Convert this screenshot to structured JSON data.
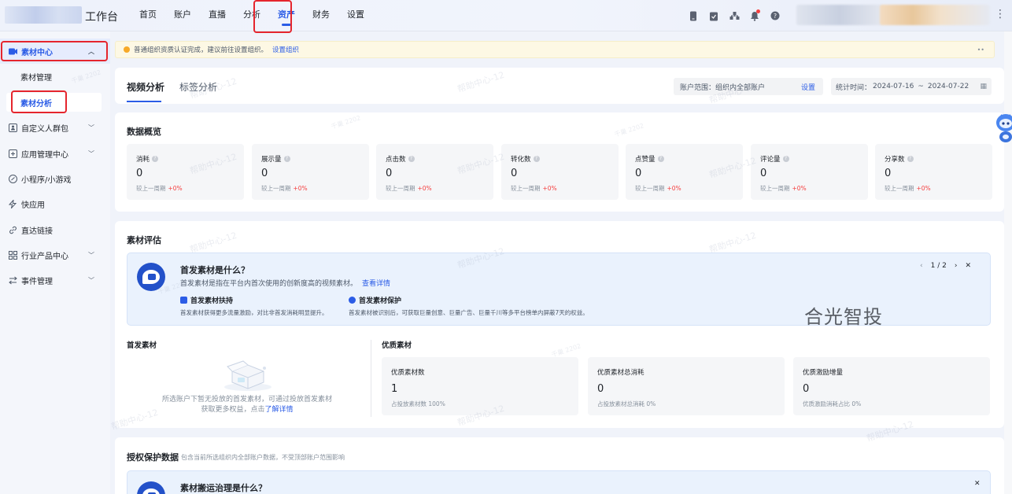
{
  "header": {
    "app_title": "工作台",
    "nav": [
      "首页",
      "账户",
      "直播",
      "分析",
      "资产",
      "财务",
      "设置"
    ],
    "active_nav": "资产",
    "icons": [
      "mobile-icon",
      "clipboard-icon",
      "org-icon",
      "bell-icon",
      "help-icon"
    ]
  },
  "sidebar": {
    "material_center": "素材中心",
    "sub_manage": "素材管理",
    "sub_analysis": "素材分析",
    "items": [
      {
        "label": "自定义人群包",
        "icon": "audience-icon",
        "chevron": true
      },
      {
        "label": "应用管理中心",
        "icon": "app-icon",
        "chevron": true
      },
      {
        "label": "小程序/小游戏",
        "icon": "miniprogram-icon",
        "chevron": false
      },
      {
        "label": "快应用",
        "icon": "quickapp-icon",
        "chevron": false
      },
      {
        "label": "直达链接",
        "icon": "link-icon",
        "chevron": false
      },
      {
        "label": "行业产品中心",
        "icon": "grid-icon",
        "chevron": true
      },
      {
        "label": "事件管理",
        "icon": "event-icon",
        "chevron": true
      }
    ]
  },
  "notice": {
    "text": "普通组织资质认证完成，建议前往设置组织。",
    "link": "设置组织"
  },
  "tabs": {
    "video": "视频分析",
    "tag": "标签分析"
  },
  "filters": {
    "range_label": "账户范围：组织内全部账户",
    "range_set": "设置",
    "date_label": "统计时间：",
    "date_start": "2024-07-16",
    "date_sep": "~",
    "date_end": "2024-07-22"
  },
  "overview": {
    "title": "数据概览",
    "compare_label": "较上一周期",
    "stats": [
      {
        "label": "消耗",
        "value": "0",
        "change": "+0%"
      },
      {
        "label": "展示量",
        "value": "0",
        "change": "+0%"
      },
      {
        "label": "点击数",
        "value": "0",
        "change": "+0%"
      },
      {
        "label": "转化数",
        "value": "0",
        "change": "+0%"
      },
      {
        "label": "点赞量",
        "value": "0",
        "change": "+0%"
      },
      {
        "label": "评论量",
        "value": "0",
        "change": "+0%"
      },
      {
        "label": "分享数",
        "value": "0",
        "change": "+0%"
      }
    ]
  },
  "evaluation": {
    "title": "素材评估",
    "banner": {
      "title": "首发素材是什么？",
      "desc": "首发素材是指在平台内首次使用的创新度高的视频素材。",
      "link": "查看详情",
      "h1": "首发素材扶持",
      "p1": "首发素材获得更多流量激励，对比非首发消耗明显提升。",
      "h2": "首发素材保护",
      "p2": "首发素材被识别后，可获取巨量创意、巨量广告、巨量千川等多平台榜单内屏蔽7天的权益。",
      "pager": "1 / 2"
    },
    "watermark": "合光智投",
    "first_title": "首发素材",
    "empty_text": "所选账户下暂无投放的首发素材，可通过投放首发素材获取更多权益，点击",
    "empty_link": "了解详情",
    "quality_title": "优质素材",
    "quality_cards": [
      {
        "label": "优质素材数",
        "value": "1",
        "sub": "占投放素材数 100%"
      },
      {
        "label": "优质素材总消耗",
        "value": "0",
        "sub": "占投放素材总消耗 0%"
      },
      {
        "label": "优质激励增量",
        "value": "0",
        "sub": "优质激励消耗占比 0%"
      }
    ]
  },
  "auth": {
    "title": "授权保护数据",
    "note": "包含当前所选组织内全部账户数据，不受顶部账户范围影响",
    "banner_title": "素材搬运治理是什么？"
  },
  "colors": {
    "accent": "#2b5ce6",
    "highlight": "#e5252d",
    "notice_bg": "#fdf8e4",
    "change_up": "#f53f3f"
  },
  "watermark_tile": {
    "label": "帮助中心-12",
    "label_small": "千巢 2202"
  }
}
